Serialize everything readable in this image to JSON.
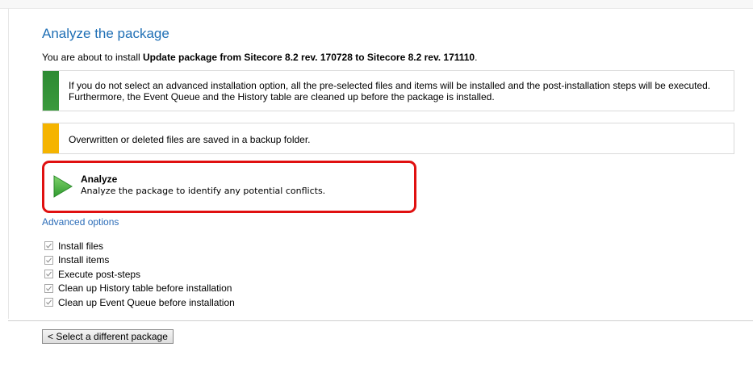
{
  "page": {
    "title": "Analyze the package",
    "intro_prefix": "You are about to install ",
    "intro_package": "Update package from Sitecore 8.2 rev. 170728 to Sitecore 8.2 rev. 171110",
    "intro_suffix": "."
  },
  "notices": {
    "info": "If you do not select an advanced installation option, all the pre-selected files and items will be installed and the post-installation steps will be executed. Furthermore, the Event Queue and the History table are cleaned up before the package is installed.",
    "warning": "Overwritten or deleted files are saved in a backup folder.",
    "info_color": "#2e8a34",
    "warning_color": "#f5b400"
  },
  "analyze": {
    "title": "Analyze",
    "description": "Analyze the package to identify any potential conflicts.",
    "icon": "play-icon",
    "icon_color": "#4caf50",
    "highlight_color": "#e01010"
  },
  "advanced": {
    "link_label": "Advanced options",
    "options": [
      {
        "label": "Install files",
        "checked": true
      },
      {
        "label": "Install items",
        "checked": true
      },
      {
        "label": "Execute post-steps",
        "checked": true
      },
      {
        "label": "Clean up History table before installation",
        "checked": true
      },
      {
        "label": "Clean up Event Queue before installation",
        "checked": true
      }
    ]
  },
  "footer": {
    "back_label": "< Select a different package"
  }
}
